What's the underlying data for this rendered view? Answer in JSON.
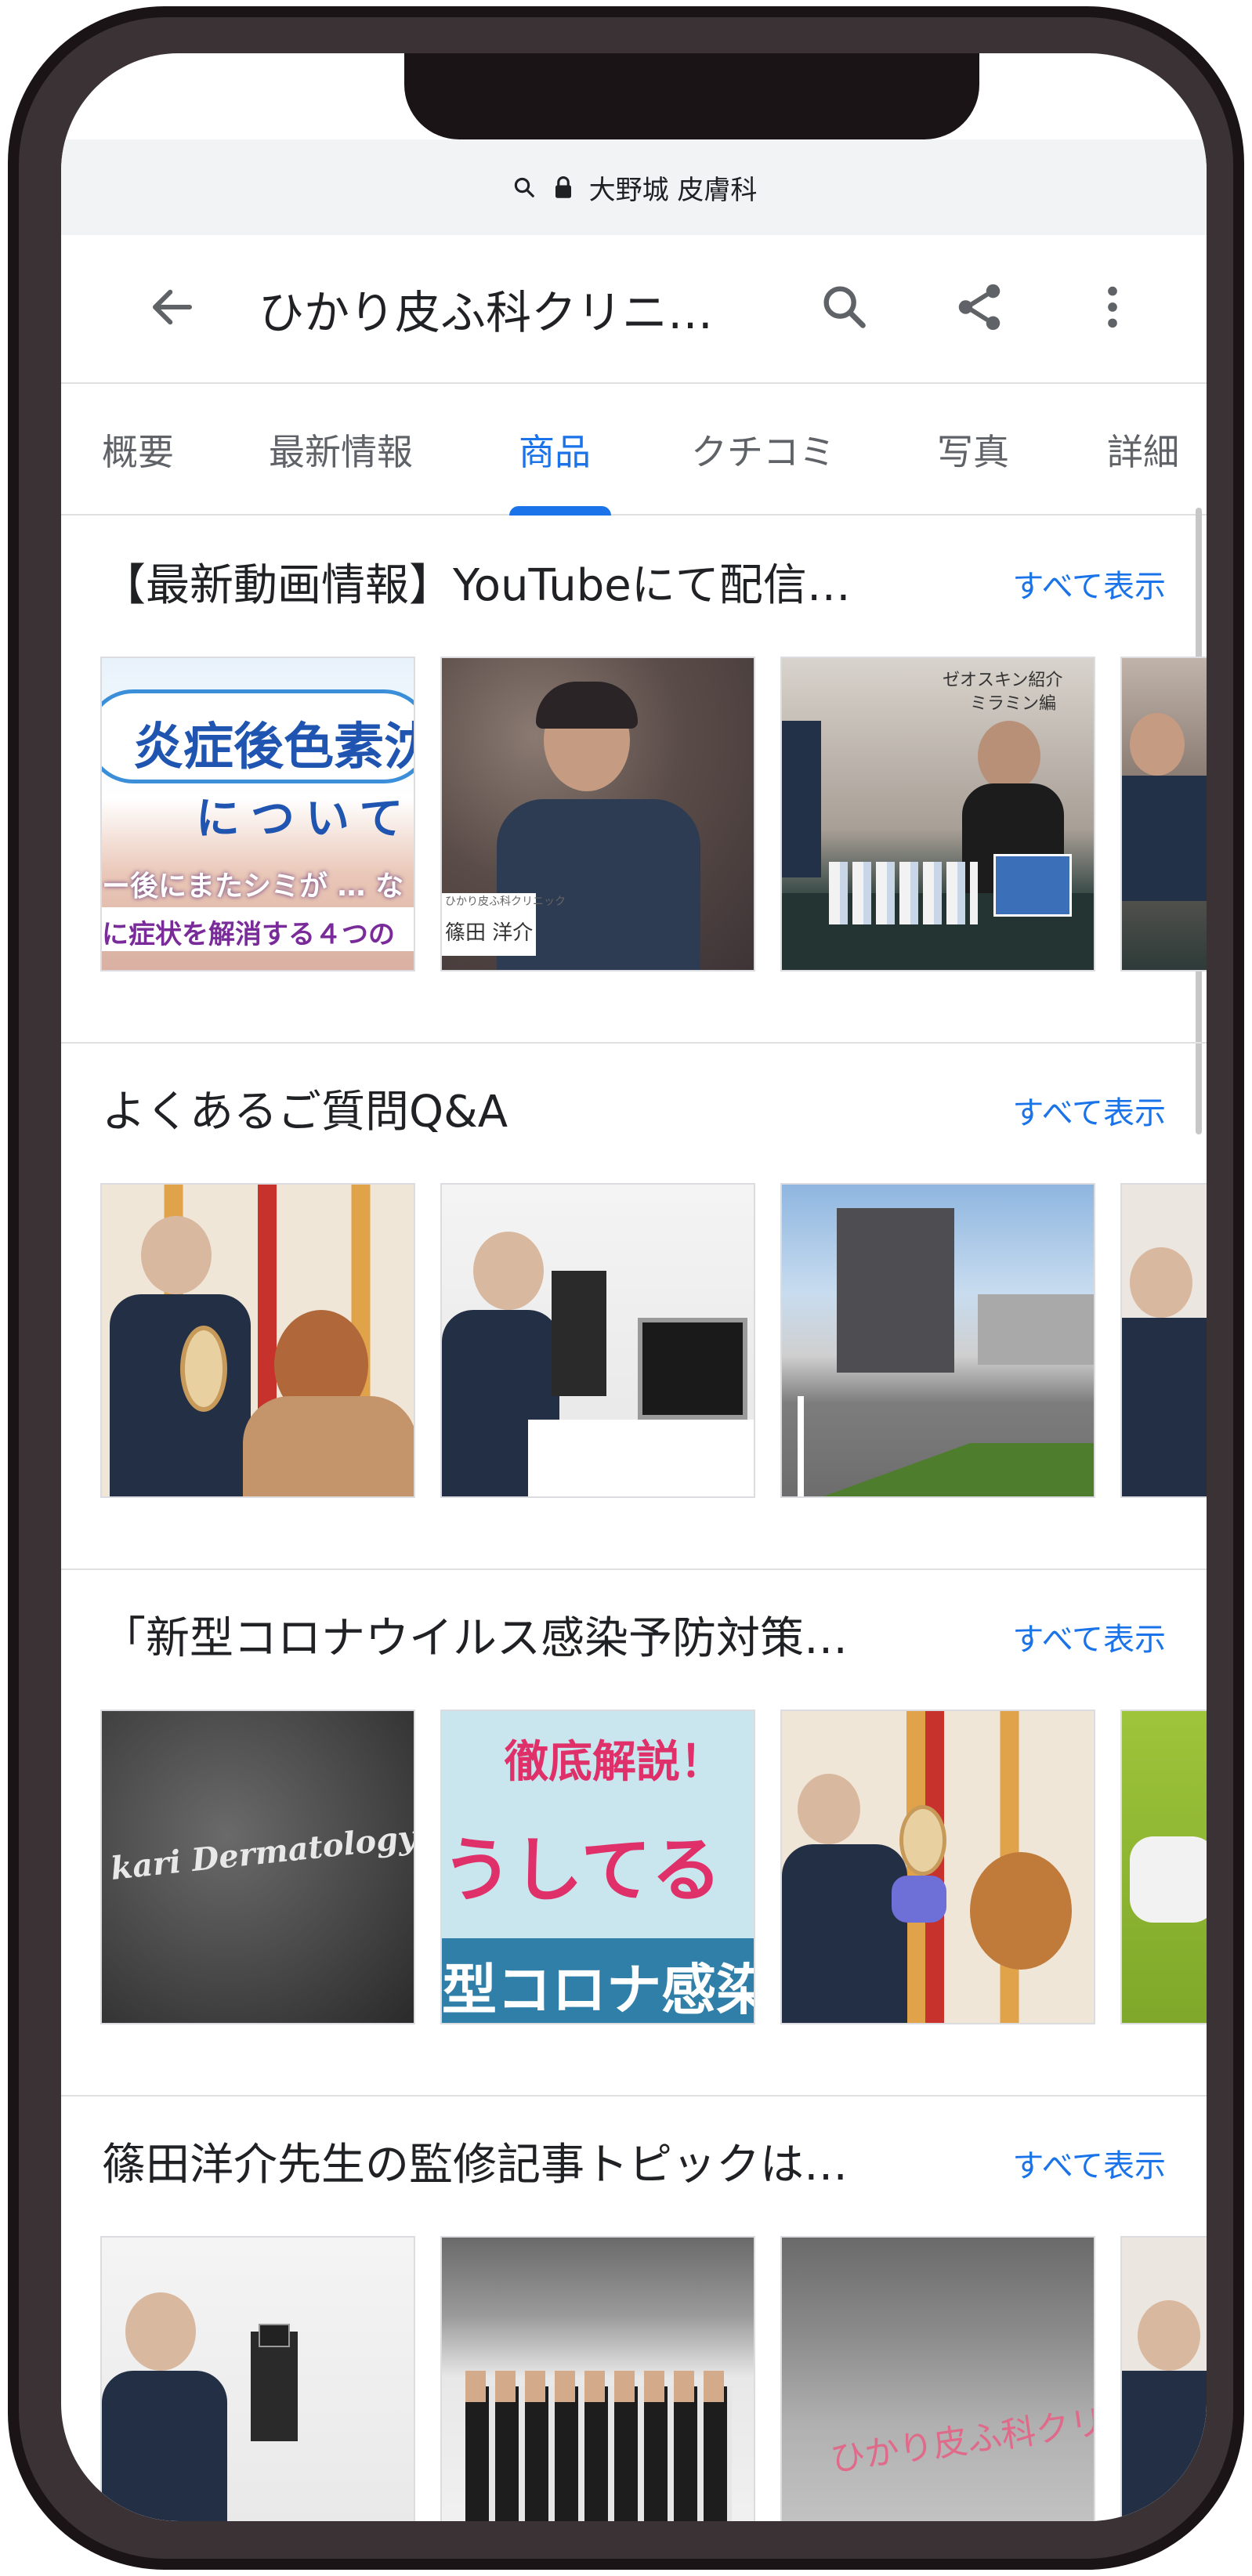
{
  "url_bar": {
    "text": "大野城 皮膚科",
    "search_icon": "search-icon",
    "lock_icon": "lock-icon"
  },
  "header": {
    "title": "ひかり皮ふ科クリニ…",
    "back_icon": "arrow-back-icon",
    "search_icon": "search-icon",
    "share_icon": "share-icon",
    "more_icon": "more-vert-icon"
  },
  "tabs": [
    {
      "label": "概要"
    },
    {
      "label": "最新情報"
    },
    {
      "label": "商品"
    },
    {
      "label": "クチコミ"
    },
    {
      "label": "写真"
    },
    {
      "label": "詳細"
    }
  ],
  "active_tab": "商品",
  "sections": [
    {
      "title": "【最新動画情報】YouTubeにて配信…",
      "see_all": "すべて表示",
      "thumbs": [
        {
          "line1": "炎症後色素沈",
          "line2": "について",
          "line3": "ー後にまたシミが … な",
          "line4": "に症状を解消する４つの"
        },
        {
          "caption": "篠田 洋介",
          "caption_small": "ひかり皮ふ科クリニック"
        },
        {
          "line1": "ゼオスキン紹介",
          "line2": "ミラミン編"
        },
        {}
      ]
    },
    {
      "title": "よくあるご質問Q&A",
      "see_all": "すべて表示",
      "thumbs": [
        {},
        {},
        {},
        {}
      ]
    },
    {
      "title": "「新型コロナウイルス感染予防対策…",
      "see_all": "すべて表示",
      "thumbs": [
        {
          "line1": "kari Dermatology Clinic"
        },
        {
          "line1": "徹底解説！",
          "line2": "うしてる",
          "line3": "型コロナ感染"
        },
        {},
        {}
      ]
    },
    {
      "title": "篠田洋介先生の監修記事トピックは…",
      "see_all": "すべて表示",
      "thumbs": [
        {},
        {},
        {
          "line1": "ひかり皮ふ科クリニ"
        },
        {}
      ]
    }
  ],
  "colors": {
    "accent": "#1a73e8",
    "frame": "#1b1416",
    "text": "#202124",
    "muted": "#5f6368"
  }
}
